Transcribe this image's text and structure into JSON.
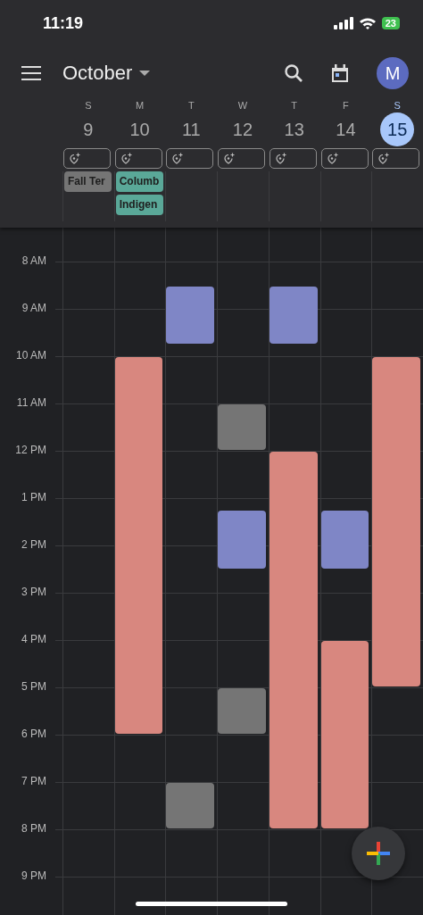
{
  "status_bar": {
    "time": "11:19",
    "battery": "23"
  },
  "app_bar": {
    "month": "October",
    "avatar": "M"
  },
  "days": [
    {
      "letter": "S",
      "number": "9",
      "selected": false,
      "all_day_events": [
        {
          "title": "Fall Ter",
          "color": "#757575"
        }
      ]
    },
    {
      "letter": "M",
      "number": "10",
      "selected": false,
      "all_day_events": [
        {
          "title": "Columb",
          "color": "#5aa898"
        },
        {
          "title": "Indigen",
          "color": "#5aa898"
        }
      ],
      "events": [
        {
          "color": "#d8877f"
        }
      ]
    },
    {
      "letter": "T",
      "number": "11",
      "selected": false,
      "events": [
        {
          "color": "#7f86c6"
        },
        {
          "color": "#757575"
        }
      ]
    },
    {
      "letter": "W",
      "number": "12",
      "selected": false,
      "events": [
        {
          "color": "#757575"
        },
        {
          "color": "#7f86c6"
        },
        {
          "color": "#757575"
        }
      ]
    },
    {
      "letter": "T",
      "number": "13",
      "selected": false,
      "events": [
        {
          "color": "#7f86c6"
        },
        {
          "color": "#d8877f"
        }
      ]
    },
    {
      "letter": "F",
      "number": "14",
      "selected": false,
      "events": [
        {
          "color": "#7f86c6"
        },
        {
          "color": "#d8877f"
        }
      ]
    },
    {
      "letter": "S",
      "number": "15",
      "selected": true,
      "events": [
        {
          "color": "#d8877f"
        }
      ]
    }
  ],
  "hours": [
    "8 AM",
    "9 AM",
    "10 AM",
    "11 AM",
    "12 PM",
    "1 PM",
    "2 PM",
    "3 PM",
    "4 PM",
    "5 PM",
    "6 PM",
    "7 PM",
    "8 PM",
    "9 PM"
  ]
}
